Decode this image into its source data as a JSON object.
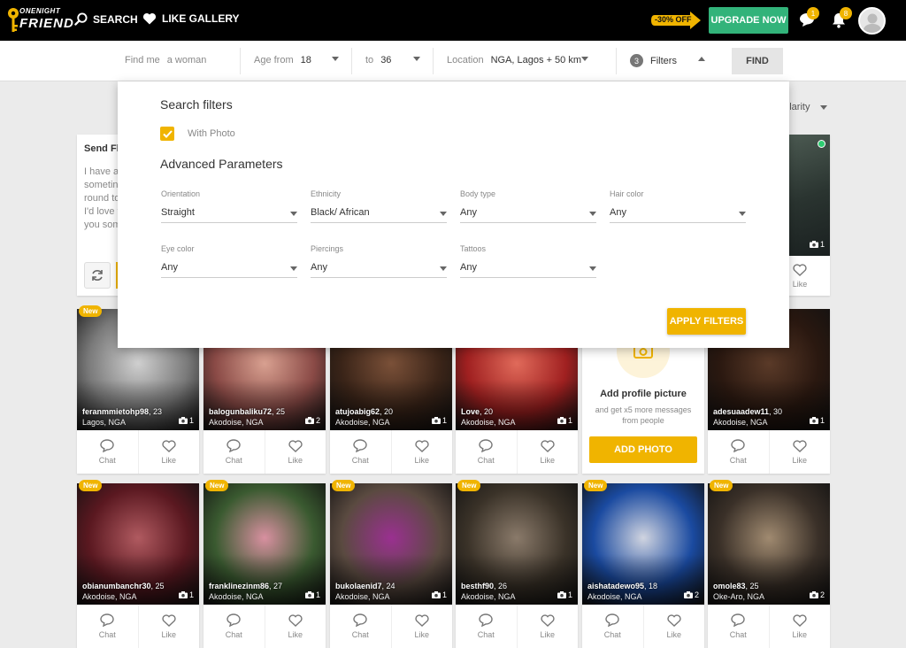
{
  "header": {
    "logo_line1": "ONENIGHT",
    "logo_line2": "FRIEND",
    "nav_search": "SEARCH",
    "nav_like_gallery": "LIKE GALLERY",
    "sale_badge": "-30% OFF",
    "upgrade_label": "UPGRADE NOW",
    "messages_count": "1",
    "notifications_count": "8"
  },
  "search": {
    "find_me_label": "Find me",
    "find_me_value": "a woman",
    "age_from_label": "Age from",
    "age_from_value": "18",
    "age_to_label": "to",
    "age_to_value": "36",
    "location_label": "Location",
    "location_value": "NGA, Lagos + 50 km",
    "filters_count": "3",
    "filters_label": "Filters",
    "find_label": "FIND"
  },
  "sort_label": "pularity",
  "flirt": {
    "title": "Send Fli",
    "lines": [
      "I have a",
      "sometin",
      "round to",
      "I'd love t",
      "you som"
    ]
  },
  "filter_panel": {
    "title": "Search filters",
    "with_photo_label": "With Photo",
    "with_photo_checked": true,
    "advanced_title": "Advanced Parameters",
    "fields": [
      {
        "label": "Orientation",
        "value": "Straight"
      },
      {
        "label": "Ethnicity",
        "value": "Black/ African"
      },
      {
        "label": "Body type",
        "value": "Any"
      },
      {
        "label": "Hair color",
        "value": "Any"
      },
      {
        "label": "Eye color",
        "value": "Any"
      },
      {
        "label": "Piercings",
        "value": "Any"
      },
      {
        "label": "Tattoos",
        "value": "Any"
      }
    ],
    "apply_label": "APPLY FILTERS"
  },
  "top_right_card": {
    "photos": "1",
    "like_label": "Like"
  },
  "add_photo_card": {
    "title": "Add profile picture",
    "subtitle": "and get x5 more messages from people",
    "button_label": "ADD PHOTO"
  },
  "labels": {
    "new": "New",
    "chat": "Chat",
    "like": "Like"
  },
  "profiles_row1": [
    {
      "name": "feranmmietohp98",
      "age": ", 23",
      "location": "Lagos, NGA",
      "photos": "1",
      "tone": "#7a7a7a",
      "tone2": "#cfcfcf"
    },
    {
      "name": "balogunbaliku72",
      "age": ", 25",
      "location": "Akodoise, NGA",
      "photos": "2",
      "tone": "#8a4a46",
      "tone2": "#d8a090"
    },
    {
      "name": "atujoabig62",
      "age": ", 20",
      "location": "Akodoise, NGA",
      "photos": "1",
      "tone": "#3a2418",
      "tone2": "#7a5038"
    },
    {
      "name": "Love",
      "age": ", 20",
      "location": "Akodoise, NGA",
      "photos": "1",
      "tone": "#a02020",
      "tone2": "#e06a5a"
    },
    {
      "name": "adesuaadew11",
      "age": ", 30",
      "location": "Akodoise, NGA",
      "photos": "1",
      "tone": "#2a1810",
      "tone2": "#5a3a28"
    }
  ],
  "profiles_row2": [
    {
      "name": "obianumbanchr30",
      "age": ", 25",
      "location": "Akodoise, NGA",
      "photos": "1",
      "tone": "#5a1820",
      "tone2": "#b05a60"
    },
    {
      "name": "franklinezinm86",
      "age": ", 27",
      "location": "Akodoise, NGA",
      "photos": "1",
      "tone": "#3a5a30",
      "tone2": "#d890a0"
    },
    {
      "name": "bukolaenid7",
      "age": ", 24",
      "location": "Akodoise, NGA",
      "photos": "1",
      "tone": "#5a4a40",
      "tone2": "#9a3090"
    },
    {
      "name": "besthf90",
      "age": ", 26",
      "location": "Akodoise, NGA",
      "photos": "1",
      "tone": "#3a3228",
      "tone2": "#8a7a6a"
    },
    {
      "name": "aishatadewo95",
      "age": ", 18",
      "location": "Akodoise, NGA",
      "photos": "2",
      "tone": "#1a4aa0",
      "tone2": "#d0d4e0"
    },
    {
      "name": "omole83",
      "age": ", 25",
      "location": "Oke-Aro, NGA",
      "photos": "2",
      "tone": "#3a3028",
      "tone2": "#a08a70"
    }
  ],
  "colors": {
    "accent": "#f0b400",
    "upgrade": "#32b37a",
    "topbar": "#000000",
    "online": "#2ecc71"
  }
}
